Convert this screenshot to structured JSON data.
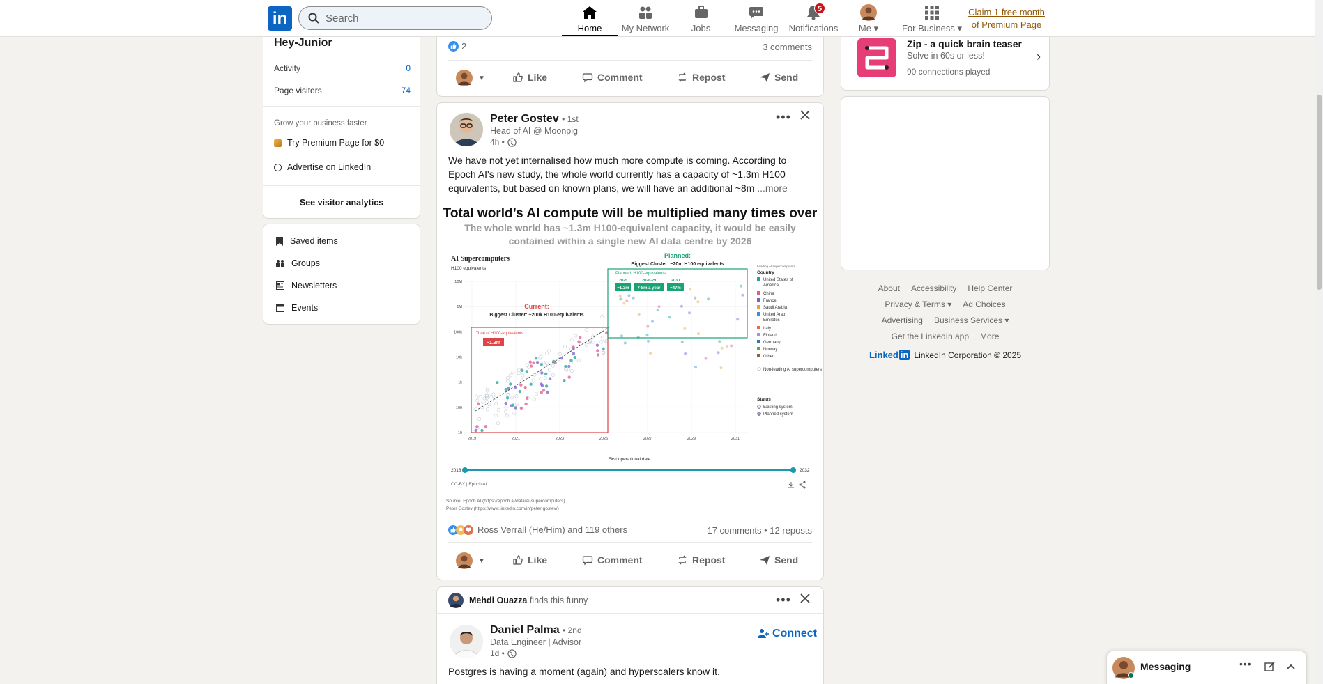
{
  "nav": {
    "logo": "in",
    "search_placeholder": "Search",
    "items": [
      {
        "label": "Home",
        "icon": "home-icon"
      },
      {
        "label": "My Network",
        "icon": "people-icon"
      },
      {
        "label": "Jobs",
        "icon": "briefcase-icon"
      },
      {
        "label": "Messaging",
        "icon": "chat-icon"
      },
      {
        "label": "Notifications",
        "icon": "bell-icon",
        "badge": "5"
      },
      {
        "label": "Me",
        "icon": "avatar-icon"
      },
      {
        "label": "For Business",
        "icon": "grid-icon"
      }
    ],
    "premium_line1": "Claim 1 free month",
    "premium_line2": "of Premium Page"
  },
  "left": {
    "page_name": "Hey-Junior",
    "activity_label": "Activity",
    "activity_value": "0",
    "visitors_label": "Page visitors",
    "visitors_value": "74",
    "grow_text": "Grow your business faster",
    "try_premium": "Try Premium Page for $0",
    "advertise": "Advertise on LinkedIn",
    "see_analytics": "See visitor analytics",
    "links": [
      "Saved items",
      "Groups",
      "Newsletters",
      "Events"
    ]
  },
  "post0": {
    "reaction_count": "2",
    "comments": "3 comments",
    "actions": [
      "Like",
      "Comment",
      "Repost",
      "Send"
    ]
  },
  "post1": {
    "author": "Peter Gostev",
    "degree": "• 1st",
    "headline": "Head of AI @ Moonpig",
    "time": "4h •",
    "text_line1": "We have not yet internalised how much more compute is coming. According to",
    "text_line2": "Epoch AI's new study, the whole world currently has a capacity of ~1.3m H100",
    "text_line3": "equivalents, but based on known plans, we will have an additional ~8m",
    "more": "...more",
    "image_title": "Total world’s AI compute will be multiplied many times over",
    "image_subtitle1": "The whole world has ~1.3m H100-equivalent capacity, it would be easily",
    "image_subtitle2": "contained within a single new AI data centre by 2026",
    "reactions_text": "Ross Verrall (He/Him) and 119 others",
    "stats": "17 comments • 12 reposts",
    "actions": [
      "Like",
      "Comment",
      "Repost",
      "Send"
    ]
  },
  "chart_data": {
    "type": "scatter",
    "title": "AI Supercomputers",
    "ylabel": "H100 equivalents",
    "xlabel": "First operational date",
    "y_ticks": [
      "10",
      "100",
      "1k",
      "10k",
      "100k",
      "1M",
      "10M"
    ],
    "y_tick_values": [
      10,
      100,
      1000,
      10000,
      100000,
      1000000,
      10000000
    ],
    "x_ticks": [
      "2019",
      "2021",
      "2023",
      "2025",
      "2027",
      "2029",
      "2031"
    ],
    "y_scale": "log",
    "current_label": "Current:",
    "current_biggest": "Biggest Cluster: ~200k H100-equivalents",
    "current_total_label": "Total of H100-equivalents",
    "current_total": "~1.3m",
    "planned_label": "Planned:",
    "planned_biggest": "Biggest Cluster: ~20m H100 equivalents",
    "planned_box_title": "Planned: H100-equivalents",
    "planned_years": [
      "2025",
      "2026-29",
      "2030"
    ],
    "planned_values": [
      "~1.3m",
      "7-8m a year",
      "~47m"
    ],
    "legend_heading": "Leading AI supercomputers",
    "legend_title": "Country",
    "countries": [
      {
        "name": "United States of America",
        "color": "#1ba39c"
      },
      {
        "name": "China",
        "color": "#e05a8a"
      },
      {
        "name": "France",
        "color": "#7b5bd6"
      },
      {
        "name": "Saudi Arabia",
        "color": "#e8a13c"
      },
      {
        "name": "United Arab Emirates",
        "color": "#3b8fd6"
      },
      {
        "name": "Italy",
        "color": "#e46f3c"
      },
      {
        "name": "Finland",
        "color": "#b28ad9"
      },
      {
        "name": "Germany",
        "color": "#2f74c0"
      },
      {
        "name": "Norway",
        "color": "#5aa84f"
      },
      {
        "name": "Other",
        "color": "#a05a3c"
      }
    ],
    "non_leading": "Non-leading AI supercomputers",
    "status_title": "Status",
    "status": [
      "Existing system",
      "Planned system"
    ],
    "slider_start": "2018",
    "slider_end": "2032",
    "credit": "CC-BY | Epoch AI",
    "source1": "Source: Epoch AI (https://epoch.ai/data/ai-supercomputers)",
    "source2": "Peter Gostev (https://www.linkedin.com/in/peter-gostev/)"
  },
  "post2": {
    "social": "Mehdi Ouazza",
    "social_suffix": "finds this funny",
    "author": "Daniel Palma",
    "degree": "• 2nd",
    "headline": "Data Engineer | Advisor",
    "time": "1d •",
    "connect": "Connect",
    "text": "Postgres is having a moment (again) and hyperscalers know it."
  },
  "right": {
    "game_title": "Zip - a quick brain teaser",
    "game_sub": "Solve in 60s or less!",
    "game_played": "90 connections played",
    "footer": [
      "About",
      "Accessibility",
      "Help Center",
      "Privacy & Terms",
      "Ad Choices",
      "Advertising",
      "Business Services",
      "Get the LinkedIn app",
      "More"
    ],
    "brand": "Linked",
    "copyright": "LinkedIn Corporation © 2025"
  },
  "messaging": {
    "label": "Messaging"
  }
}
